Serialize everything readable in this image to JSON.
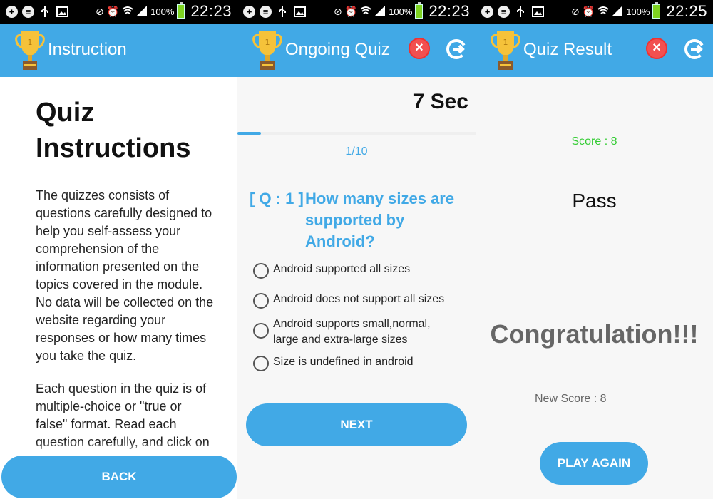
{
  "status_bars": [
    {
      "battery": "100%",
      "time": "22:23"
    },
    {
      "battery": "100%",
      "time": "22:23"
    },
    {
      "battery": "100%",
      "time": "22:25"
    }
  ],
  "instruction_screen": {
    "title": "Instruction",
    "heading": "Quiz Instructions",
    "paragraph1": "The quizzes consists of questions carefully designed to help you self-assess your comprehension of the information presented on the topics covered in the module. No data will be collected on the website regarding your responses or how many times you take the quiz.",
    "paragraph2": "Each question in the quiz is of multiple-choice or \"true or false\" format. Read each question carefully, and click on",
    "back_label": "BACK"
  },
  "quiz_screen": {
    "title": "Ongoing Quiz",
    "timer": "7 Sec",
    "progress": 0.1,
    "counter": "1/10",
    "question_tag": "[ Q : 1 ]",
    "question": "How many sizes are supported by Android?",
    "options": [
      "Android supported all sizes",
      "Android does not support all sizes",
      "Android supports small,normal, large and extra-large sizes",
      "Size is undefined in android"
    ],
    "next_label": "NEXT"
  },
  "result_screen": {
    "title": "Quiz Result",
    "score": "Score : 8",
    "status": "Pass",
    "message": "Congratulation!!!",
    "new_score": "New Score : 8",
    "play_again_label": "PLAY AGAIN"
  },
  "colors": {
    "primary": "#41a9e6",
    "close": "#f25050",
    "score": "#33cc33"
  }
}
